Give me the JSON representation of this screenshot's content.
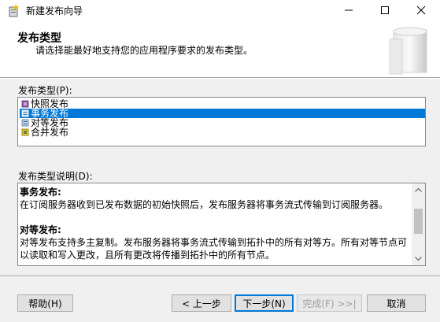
{
  "window": {
    "title": "新建发布向导"
  },
  "header": {
    "title": "发布类型",
    "subtitle": "请选择能最好地支持您的应用程序要求的发布类型。"
  },
  "types": {
    "label": "发布类型(P):",
    "items": [
      {
        "label": "快照发布",
        "icon": "snapshot-publication-icon",
        "selected": false
      },
      {
        "label": "事务发布",
        "icon": "transactional-publication-icon",
        "selected": true
      },
      {
        "label": "对等发布",
        "icon": "peer-to-peer-publication-icon",
        "selected": false
      },
      {
        "label": "合并发布",
        "icon": "merge-publication-icon",
        "selected": false
      }
    ]
  },
  "description": {
    "label": "发布类型说明(D):",
    "sections": [
      {
        "heading": "事务发布:",
        "text": "在订阅服务器收到已发布数据的初始快照后，发布服务器将事务流式传输到订阅服务器。"
      },
      {
        "heading": "对等发布:",
        "text": "对等发布支持多主复制。发布服务器将事务流式传输到拓扑中的所有对等方。所有对等节点可以读取和写入更改，且所有更改将传播到拓扑中的所有节点。"
      }
    ]
  },
  "buttons": {
    "help": "帮助(H)",
    "prev": "< 上一步",
    "next": "下一步(N)",
    "finish": "完成(F) >>|",
    "cancel": "取消"
  },
  "colors": {
    "selection": "#0078d7",
    "window_bg": "#f0f0f0"
  }
}
